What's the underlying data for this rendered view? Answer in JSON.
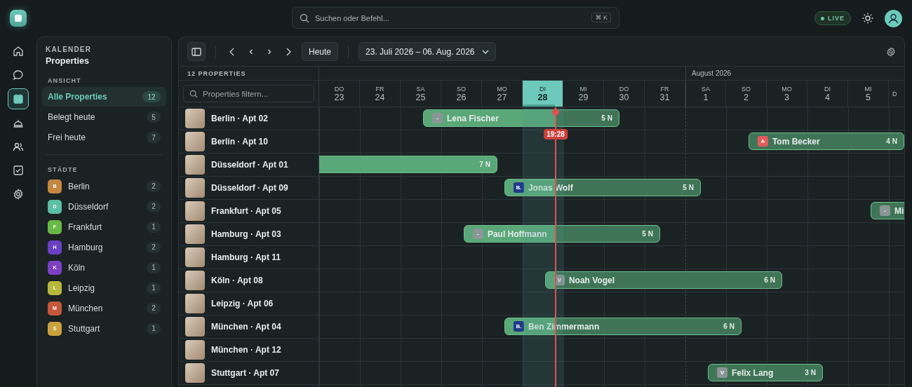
{
  "search": {
    "placeholder": "Suchen oder Befehl...",
    "shortcut": "⌘ K"
  },
  "status": {
    "label": "LIVE"
  },
  "rail": [
    {
      "kind": "home",
      "selected": false
    },
    {
      "kind": "chat",
      "selected": false
    },
    {
      "kind": "calendar",
      "selected": true
    },
    {
      "kind": "bell",
      "selected": false
    },
    {
      "kind": "users",
      "selected": false
    },
    {
      "kind": "tasks",
      "selected": false
    },
    {
      "kind": "settings",
      "selected": false
    }
  ],
  "sidebar": {
    "eyebrow": "KALENDER",
    "title": "Properties",
    "view_heading": "ANSICHT",
    "views": [
      {
        "label": "Alle Properties",
        "count": "12",
        "selected": true
      },
      {
        "label": "Belegt heute",
        "count": "5",
        "selected": false
      },
      {
        "label": "Frei heute",
        "count": "7",
        "selected": false
      }
    ],
    "cities_heading": "STÄDTE",
    "cities": [
      {
        "letter": "B",
        "name": "Berlin",
        "count": "2",
        "color": "#c4873f"
      },
      {
        "letter": "D",
        "name": "Düsseldorf",
        "count": "2",
        "color": "#5bbfa6"
      },
      {
        "letter": "F",
        "name": "Frankfurt",
        "count": "1",
        "color": "#6ab845"
      },
      {
        "letter": "H",
        "name": "Hamburg",
        "count": "2",
        "color": "#6a3fc4"
      },
      {
        "letter": "K",
        "name": "Köln",
        "count": "1",
        "color": "#7d3fc4"
      },
      {
        "letter": "L",
        "name": "Leipzig",
        "count": "1",
        "color": "#b8b83c"
      },
      {
        "letter": "M",
        "name": "München",
        "count": "2",
        "color": "#c4583a"
      },
      {
        "letter": "S",
        "name": "Stuttgart",
        "count": "1",
        "color": "#c9a23d"
      }
    ]
  },
  "toolbar": {
    "today_button": "Heute",
    "range": "23. Juli 2026 – 06. Aug. 2026"
  },
  "grid": {
    "count_label": "12 PROPERTIES",
    "filter_placeholder": "Properties filtern...",
    "days": [
      {
        "dow": "DO",
        "day": "23",
        "selected": false
      },
      {
        "dow": "FR",
        "day": "24",
        "selected": false
      },
      {
        "dow": "SA",
        "day": "25",
        "selected": false
      },
      {
        "dow": "SO",
        "day": "26",
        "selected": false
      },
      {
        "dow": "MO",
        "day": "27",
        "selected": false
      },
      {
        "dow": "DI",
        "day": "28",
        "selected": true
      },
      {
        "dow": "MI",
        "day": "29",
        "selected": false
      },
      {
        "dow": "DO",
        "day": "30",
        "selected": false
      },
      {
        "dow": "FR",
        "day": "31",
        "selected": false
      },
      {
        "dow": "SA",
        "day": "1",
        "selected": false,
        "month": "August 2026"
      },
      {
        "dow": "SO",
        "day": "2",
        "selected": false
      },
      {
        "dow": "MO",
        "day": "3",
        "selected": false
      },
      {
        "dow": "DI",
        "day": "4",
        "selected": false
      },
      {
        "dow": "MI",
        "day": "5",
        "selected": false
      },
      {
        "dow": "D",
        "selected": false
      }
    ],
    "now": {
      "label": "19:28",
      "level": 0.81
    },
    "rows": [
      {
        "name": "Berlin · Apt 02",
        "bookings": [
          {
            "guest": "Lena Fischer",
            "badge": "-",
            "color": "#8a9696",
            "nights": "5 N"
          }
        ]
      },
      {
        "name": "Berlin · Apt 10",
        "bookings": [
          {
            "guest": "Tom Becker",
            "badge": "A",
            "color": "#e05c5c",
            "nights": "4 N"
          }
        ]
      },
      {
        "name": "Düsseldorf · Apt 01",
        "bookings": [
          {
            "nights": "7 N"
          }
        ]
      },
      {
        "name": "Düsseldorf · Apt 09",
        "bookings": [
          {
            "guest": "Jonas Wolf",
            "badge": "B.",
            "color": "#1f3a8a",
            "nights": "5 N"
          }
        ]
      },
      {
        "name": "Frankfurt · Apt 05",
        "bookings": [
          {
            "guest": "Mi",
            "badge": "-",
            "color": "#8a9696"
          }
        ]
      },
      {
        "name": "Hamburg · Apt 03",
        "bookings": [
          {
            "guest": "Paul Hoffmann",
            "badge": "-",
            "color": "#8a9696",
            "nights": "5 N"
          }
        ]
      },
      {
        "name": "Hamburg · Apt 11",
        "bookings": []
      },
      {
        "name": "Köln · Apt 08",
        "bookings": [
          {
            "guest": "Noah Vogel",
            "badge": "V",
            "color": "#8a9696",
            "nights": "6 N"
          }
        ]
      },
      {
        "name": "Leipzig · Apt 06",
        "bookings": []
      },
      {
        "name": "München · Apt 04",
        "bookings": [
          {
            "guest": "Ben Zimmermann",
            "badge": "B.",
            "color": "#1f3a8a",
            "nights": "6 N"
          }
        ]
      },
      {
        "name": "München · Apt 12",
        "bookings": []
      },
      {
        "name": "Stuttgart · Apt 07",
        "bookings": [
          {
            "guest": "Felix Lang",
            "badge": "V",
            "color": "#8a9696",
            "nights": "3 N"
          }
        ]
      }
    ]
  }
}
